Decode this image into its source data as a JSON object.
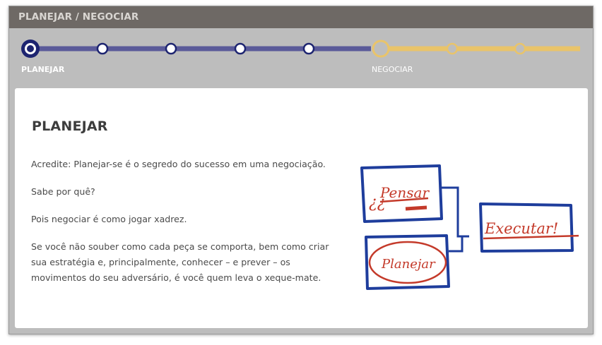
{
  "header": {
    "title": "PLANEJAR / NEGOCIAR"
  },
  "timeline": {
    "steps": [
      {
        "label": "PLANEJAR",
        "state": "current"
      },
      {
        "label": "",
        "state": "done"
      },
      {
        "label": "",
        "state": "done"
      },
      {
        "label": "",
        "state": "done"
      },
      {
        "label": "",
        "state": "done"
      },
      {
        "label": "NEGOCIAR",
        "state": "pending"
      },
      {
        "label": "",
        "state": "pending"
      },
      {
        "label": "",
        "state": "pending"
      }
    ],
    "colors": {
      "active": "#1d2470",
      "track_done": "#5a5a99",
      "pending": "#e9c46a"
    }
  },
  "content": {
    "title": "PLANEJAR",
    "paragraphs": [
      "Acredite: Planejar-se é o segredo do sucesso em uma negociação.",
      "Sabe por quê?",
      "Pois negociar é como jogar xadrez.",
      "Se você não souber como cada peça se comporta, bem como criar sua estratégia e, principalmente, conhecer – e prever – os movimentos do seu adversário, é você quem leva o xeque-mate."
    ]
  },
  "illustration": {
    "boxes": [
      "Pensar",
      "Planejar",
      "Executar!"
    ],
    "marks": "¿¿",
    "colors": {
      "frame": "#1e3d9c",
      "text": "#c43a2a"
    }
  }
}
